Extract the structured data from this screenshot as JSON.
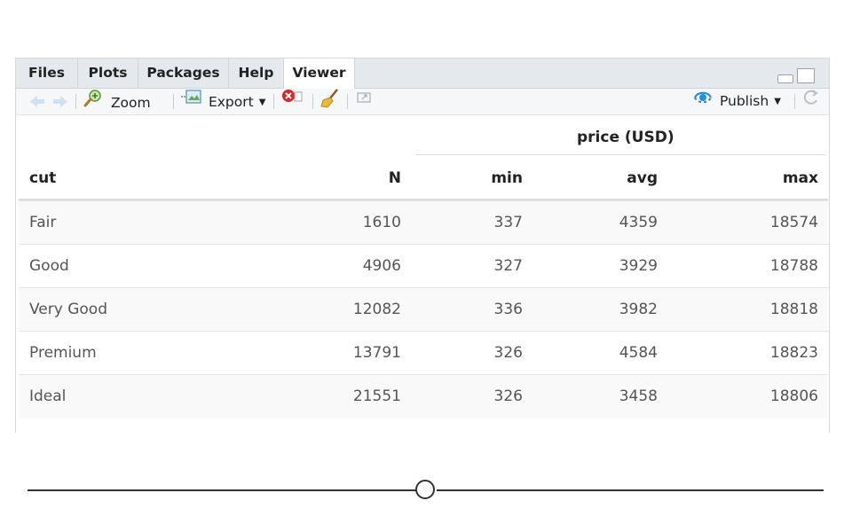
{
  "tabs": [
    "Files",
    "Plots",
    "Packages",
    "Help",
    "Viewer"
  ],
  "toolbar": {
    "zoom_label": "Zoom",
    "export_label": "Export",
    "publish_label": "Publish",
    "icons": [
      "back-arrow-icon",
      "forward-arrow-icon",
      "zoom-icon",
      "export-icon",
      "clear-icon",
      "broom-icon",
      "popout-icon",
      "publish-icon",
      "refresh-icon"
    ]
  },
  "table": {
    "group_header": "price (USD)",
    "columns": [
      "cut",
      "N",
      "min",
      "avg",
      "max"
    ],
    "rows": [
      [
        "Fair",
        "1610",
        "337",
        "4359",
        "18574"
      ],
      [
        "Good",
        "4906",
        "327",
        "3929",
        "18788"
      ],
      [
        "Very Good",
        "12082",
        "336",
        "3982",
        "18818"
      ],
      [
        "Premium",
        "13791",
        "326",
        "4584",
        "18823"
      ],
      [
        "Ideal",
        "21551",
        "326",
        "3458",
        "18806"
      ]
    ]
  },
  "colors": {
    "publish_accent": "#2a8fd6",
    "clear_red": "#d9262b"
  }
}
